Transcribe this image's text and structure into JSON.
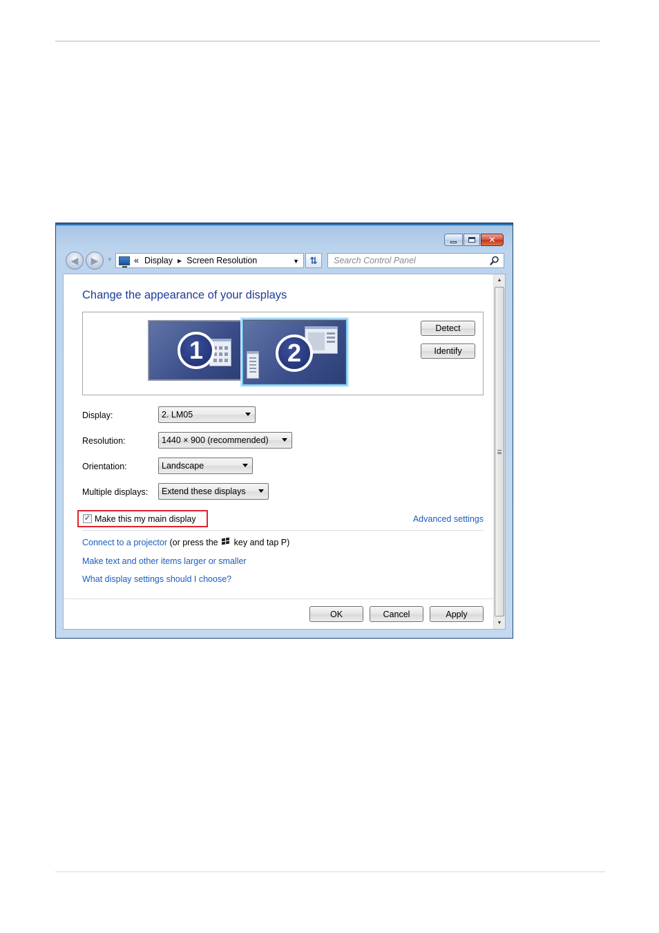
{
  "window": {
    "controls": {
      "minimize": "minimize",
      "maximize": "maximize",
      "close": "✕"
    }
  },
  "address_bar": {
    "chevron": "«",
    "crumbs": [
      "Display",
      "Screen Resolution"
    ],
    "search_placeholder": "Search Control Panel"
  },
  "page": {
    "heading": "Change the appearance of your displays",
    "monitors": [
      {
        "number": "1",
        "selected": false
      },
      {
        "number": "2",
        "selected": true
      }
    ],
    "detect_label": "Detect",
    "identify_label": "Identify",
    "form": {
      "display_label": "Display:",
      "display_value": "2. LM05",
      "resolution_label": "Resolution:",
      "resolution_value": "1440 × 900 (recommended)",
      "orientation_label": "Orientation:",
      "orientation_value": "Landscape",
      "multiple_label": "Multiple displays:",
      "multiple_value": "Extend these displays"
    },
    "main_display_label": "Make this my main display",
    "main_display_checked": true,
    "advanced_link": "Advanced settings",
    "projector_link": "Connect to a projector",
    "projector_text_before": " (or press the",
    "projector_text_after": "key and tap P)",
    "larger_link": "Make text and other items larger or smaller",
    "settings_link": "What display settings should I choose?",
    "buttons": {
      "ok": "OK",
      "cancel": "Cancel",
      "apply": "Apply"
    }
  },
  "colors": {
    "accent": "#1e3c96",
    "link": "#1c5bbd",
    "highlight_box": "#e0212a",
    "selected_monitor": "#7cc8f5"
  },
  "icons": {
    "back": "back-arrow-icon",
    "forward": "forward-arrow-icon",
    "refresh": "refresh-icon",
    "search": "search-icon",
    "windows_key": "windows-logo-icon"
  }
}
